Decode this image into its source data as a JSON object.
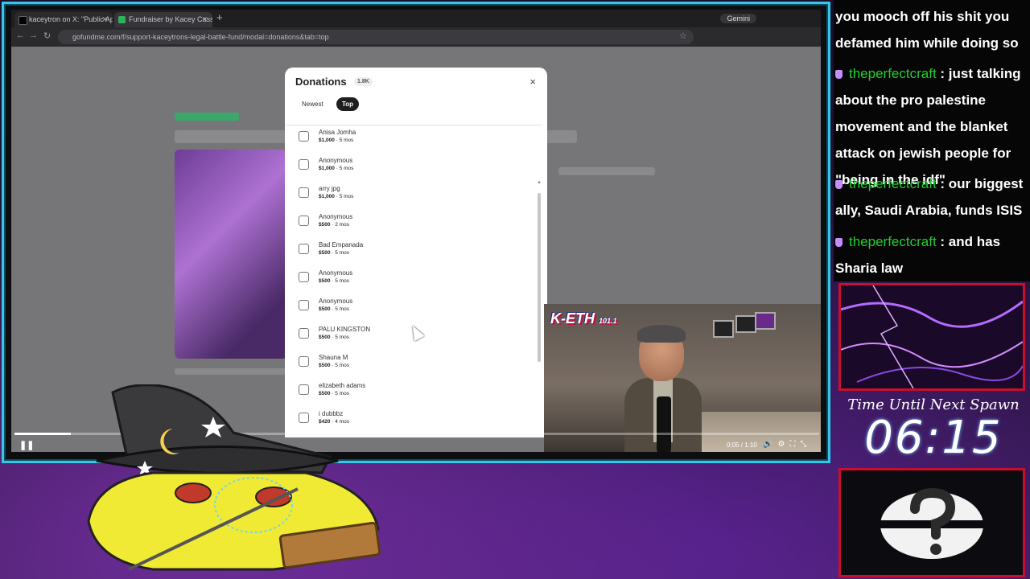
{
  "browser": {
    "tabs": [
      {
        "label": "kaceytron on X: \"Public Apolog"
      },
      {
        "label": "Fundraiser by Kacey Cassano"
      }
    ],
    "gemini_label": "Gemini",
    "url": "gofundme.com/f/support-kaceytrons-legal-battle-fund/modal=donations&tab=top"
  },
  "donations_modal": {
    "title": "Donations",
    "count": "1.8K",
    "close": "×",
    "tabs": {
      "newest": "Newest",
      "top": "Top"
    },
    "donors": [
      {
        "name": "Anisa Jomha",
        "amount": "$1,000",
        "time": " · 5 mos"
      },
      {
        "name": "Anonymous",
        "amount": "$1,000",
        "time": " · 5 mos"
      },
      {
        "name": "arry jpg",
        "amount": "$1,000",
        "time": " · 5 mos"
      },
      {
        "name": "Anonymous",
        "amount": "$500",
        "time": " · 2 mos"
      },
      {
        "name": "Bad Empanada",
        "amount": "$500",
        "time": " · 5 mos"
      },
      {
        "name": "Anonymous",
        "amount": "$500",
        "time": " · 5 mos"
      },
      {
        "name": "Anonymous",
        "amount": "$500",
        "time": " · 5 mos"
      },
      {
        "name": "PALU KINGSTON",
        "amount": "$500",
        "time": " · 5 mos"
      },
      {
        "name": "Shauna M",
        "amount": "$500",
        "time": " · 5 mos"
      },
      {
        "name": "elizabeth adams",
        "amount": "$500",
        "time": " · 5 mos"
      },
      {
        "name": "i dubbbz",
        "amount": "$420",
        "time": " · 4 mos"
      }
    ]
  },
  "video": {
    "time": "0:05 / 1:10",
    "progress": 0.07,
    "play_icon": "pause-icon",
    "logo_text": "K-ETH",
    "logo_sub": "101.1"
  },
  "chat": {
    "messages": [
      {
        "user": "",
        "text": "you mooch off his shit you defamed him while doing so"
      },
      {
        "user": "theperfectcraft",
        "text": " : just talking about the pro palestine movement and the blanket attack on jewish people for \"being in the idf\""
      },
      {
        "user": "theperfectcraft",
        "text": " : our biggest ally, Saudi Arabia, funds ISIS"
      },
      {
        "user": "theperfectcraft",
        "text": " : and has Sharia law"
      }
    ]
  },
  "spawn": {
    "label": "Time Until Next Spawn",
    "value": "06:15"
  },
  "colors": {
    "frame": "#36c7e8",
    "panel_border": "#c8102e",
    "chat_user": "#1fd12b",
    "badge": "#c58cff"
  }
}
